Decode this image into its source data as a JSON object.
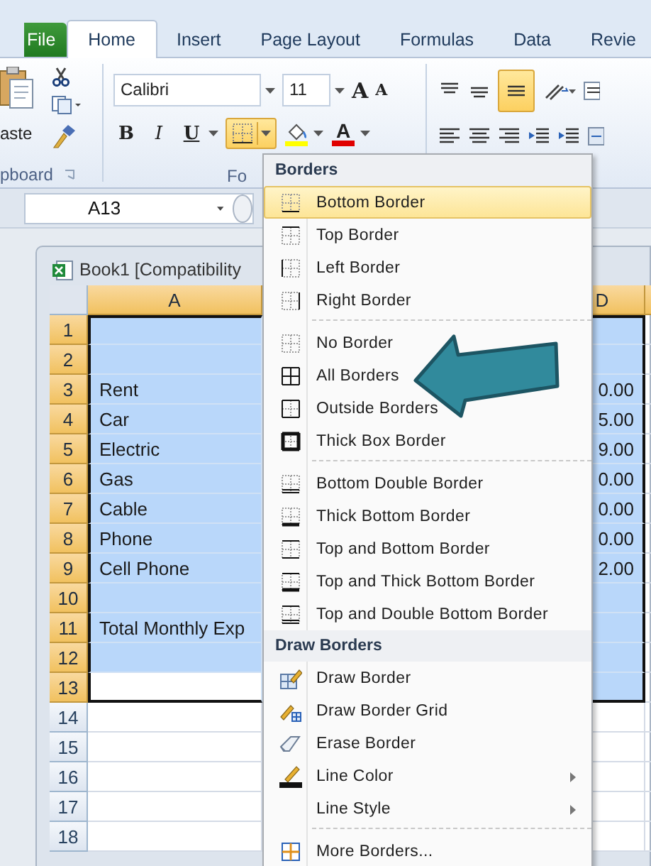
{
  "tabs": [
    {
      "label": "File",
      "kind": "file",
      "selected": false
    },
    {
      "label": "Home",
      "kind": "tab",
      "selected": true
    },
    {
      "label": "Insert",
      "kind": "tab",
      "selected": false
    },
    {
      "label": "Page Layout",
      "kind": "tab",
      "selected": false
    },
    {
      "label": "Formulas",
      "kind": "tab",
      "selected": false
    },
    {
      "label": "Data",
      "kind": "tab",
      "selected": false
    },
    {
      "label": "Revie",
      "kind": "tab",
      "selected": false
    }
  ],
  "clipboard": {
    "paste_label": "aste",
    "group_label": "pboard"
  },
  "font": {
    "family": "Calibri",
    "size": "11",
    "grow": "A",
    "shrink": "A",
    "bold": "B",
    "italic": "I",
    "underline": "U",
    "font_color": "A",
    "group_label": "Fo",
    "borders_active": true
  },
  "alignment": {
    "bottom_align_active": true
  },
  "name_box": "A13",
  "workbook": {
    "title": "Book1  [Compatibility"
  },
  "sheet": {
    "columns": [
      {
        "label": "A",
        "selected": true
      },
      {
        "label": "D",
        "selected": true
      }
    ],
    "rows": [
      {
        "header": "1",
        "selected": true
      },
      {
        "header": "2",
        "selected": true
      },
      {
        "header": "3",
        "label": "Rent",
        "amount": "0.00",
        "selected": true
      },
      {
        "header": "4",
        "label": "Car",
        "amount": "5.00",
        "selected": true
      },
      {
        "header": "5",
        "label": "Electric",
        "amount": "9.00",
        "selected": true
      },
      {
        "header": "6",
        "label": "Gas",
        "amount": "0.00",
        "selected": true
      },
      {
        "header": "7",
        "label": "Cable",
        "amount": "0.00",
        "selected": true
      },
      {
        "header": "8",
        "label": "Phone",
        "amount": "0.00",
        "selected": true
      },
      {
        "header": "9",
        "label": "Cell Phone",
        "amount": "2.00",
        "selected": true
      },
      {
        "header": "10",
        "selected": true
      },
      {
        "header": "11",
        "label": "Total Monthly  Exp",
        "selected": true
      },
      {
        "header": "12",
        "selected": true
      },
      {
        "header": "13",
        "selected": true,
        "active": true
      },
      {
        "header": "14",
        "selected": false
      },
      {
        "header": "15",
        "selected": false
      },
      {
        "header": "16",
        "selected": false
      },
      {
        "header": "17",
        "selected": false
      },
      {
        "header": "18",
        "selected": false
      }
    ]
  },
  "menu": {
    "sections": [
      {
        "title": "Borders",
        "groups": [
          [
            {
              "label": "Bottom Border",
              "highlighted": true
            },
            {
              "label": "Top Border",
              "highlighted": false
            },
            {
              "label": "Left Border",
              "highlighted": false
            },
            {
              "label": "Right Border",
              "highlighted": false
            }
          ],
          [
            {
              "label": "No Border",
              "highlighted": false
            },
            {
              "label": "All Borders",
              "highlighted": false
            },
            {
              "label": "Outside Borders",
              "highlighted": false
            },
            {
              "label": "Thick Box Border",
              "highlighted": false
            }
          ],
          [
            {
              "label": "Bottom Double Border",
              "highlighted": false
            },
            {
              "label": "Thick Bottom Border",
              "highlighted": false
            },
            {
              "label": "Top and Bottom Border",
              "highlighted": false
            },
            {
              "label": "Top and Thick Bottom Border",
              "highlighted": false
            },
            {
              "label": "Top and Double Bottom Border",
              "highlighted": false
            }
          ]
        ]
      },
      {
        "title": "Draw Borders",
        "groups": [
          [
            {
              "label": "Draw Border",
              "highlighted": false
            },
            {
              "label": "Draw Border Grid",
              "highlighted": false
            },
            {
              "label": "Erase Border",
              "highlighted": false
            },
            {
              "label": "Line Color",
              "highlighted": false,
              "submenu": true
            },
            {
              "label": "Line Style",
              "highlighted": false,
              "submenu": true
            }
          ],
          [
            {
              "label": "More Borders...",
              "highlighted": false
            }
          ]
        ]
      }
    ]
  }
}
